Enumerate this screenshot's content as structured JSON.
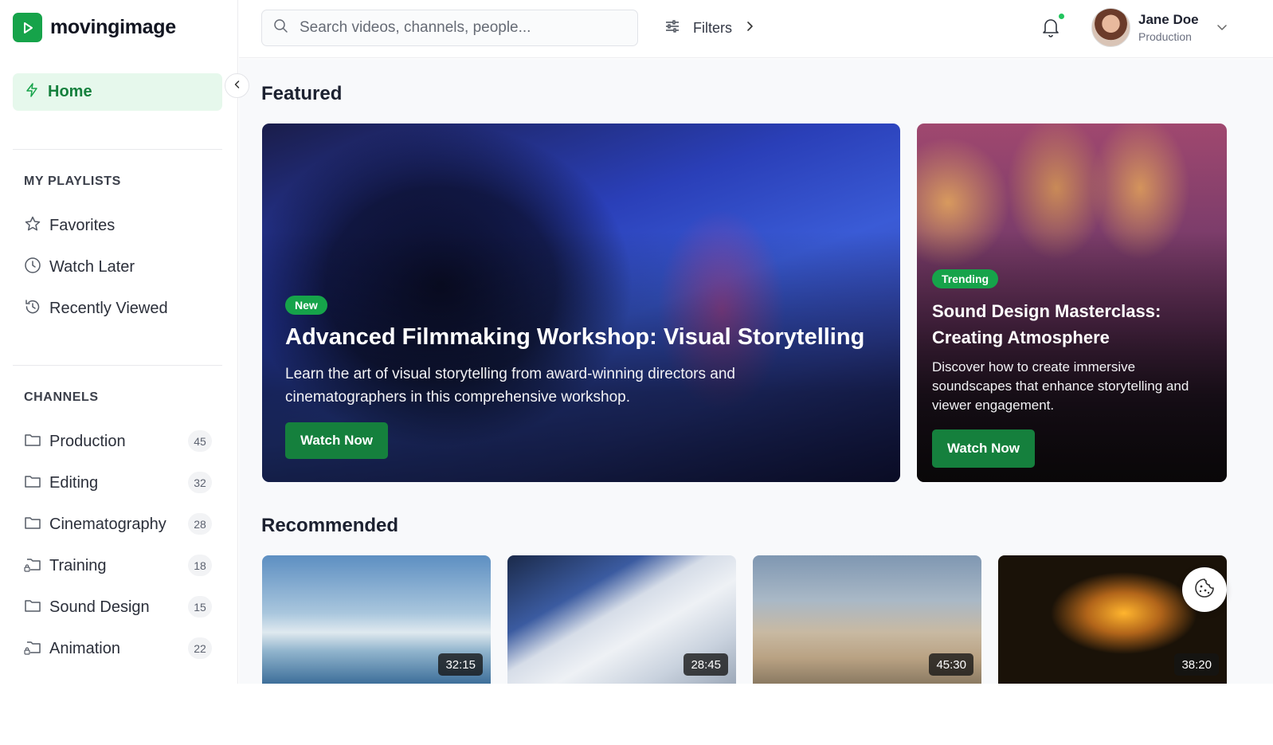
{
  "app": {
    "name": "movingimage"
  },
  "sidebar": {
    "home_label": "Home",
    "playlists_title": "MY PLAYLISTS",
    "playlists": [
      {
        "label": "Favorites",
        "icon": "star-icon"
      },
      {
        "label": "Watch Later",
        "icon": "clock-icon"
      },
      {
        "label": "Recently Viewed",
        "icon": "history-icon"
      }
    ],
    "channels_title": "CHANNELS",
    "channels": [
      {
        "label": "Production",
        "count": "45",
        "icon": "folder-icon"
      },
      {
        "label": "Editing",
        "count": "32",
        "icon": "folder-icon"
      },
      {
        "label": "Cinematography",
        "count": "28",
        "icon": "folder-icon"
      },
      {
        "label": "Training",
        "count": "18",
        "icon": "folder-lock-icon"
      },
      {
        "label": "Sound Design",
        "count": "15",
        "icon": "folder-icon"
      },
      {
        "label": "Animation",
        "count": "22",
        "icon": "folder-lock-icon"
      }
    ]
  },
  "topbar": {
    "search_placeholder": "Search videos, channels, people...",
    "filters_label": "Filters",
    "user": {
      "name": "Jane Doe",
      "role": "Production"
    }
  },
  "featured": {
    "heading": "Featured",
    "items": [
      {
        "tag": "New",
        "title": "Advanced Filmmaking Workshop: Visual Storytelling",
        "description": "Learn the art of visual storytelling from award-winning directors and cinematographers in this comprehensive workshop.",
        "cta": "Watch Now"
      },
      {
        "tag": "Trending",
        "title": "Sound Design Masterclass: Creating Atmosphere",
        "description": "Discover how to create immersive soundscapes that enhance storytelling and viewer engagement.",
        "cta": "Watch Now"
      }
    ]
  },
  "recommended": {
    "heading": "Recommended",
    "items": [
      {
        "duration": "32:15"
      },
      {
        "duration": "28:45"
      },
      {
        "duration": "45:30"
      },
      {
        "duration": "38:20"
      }
    ]
  },
  "colors": {
    "accent": "#16a34a",
    "accent_dark": "#15803d",
    "home_bg": "#e6f8ec"
  }
}
